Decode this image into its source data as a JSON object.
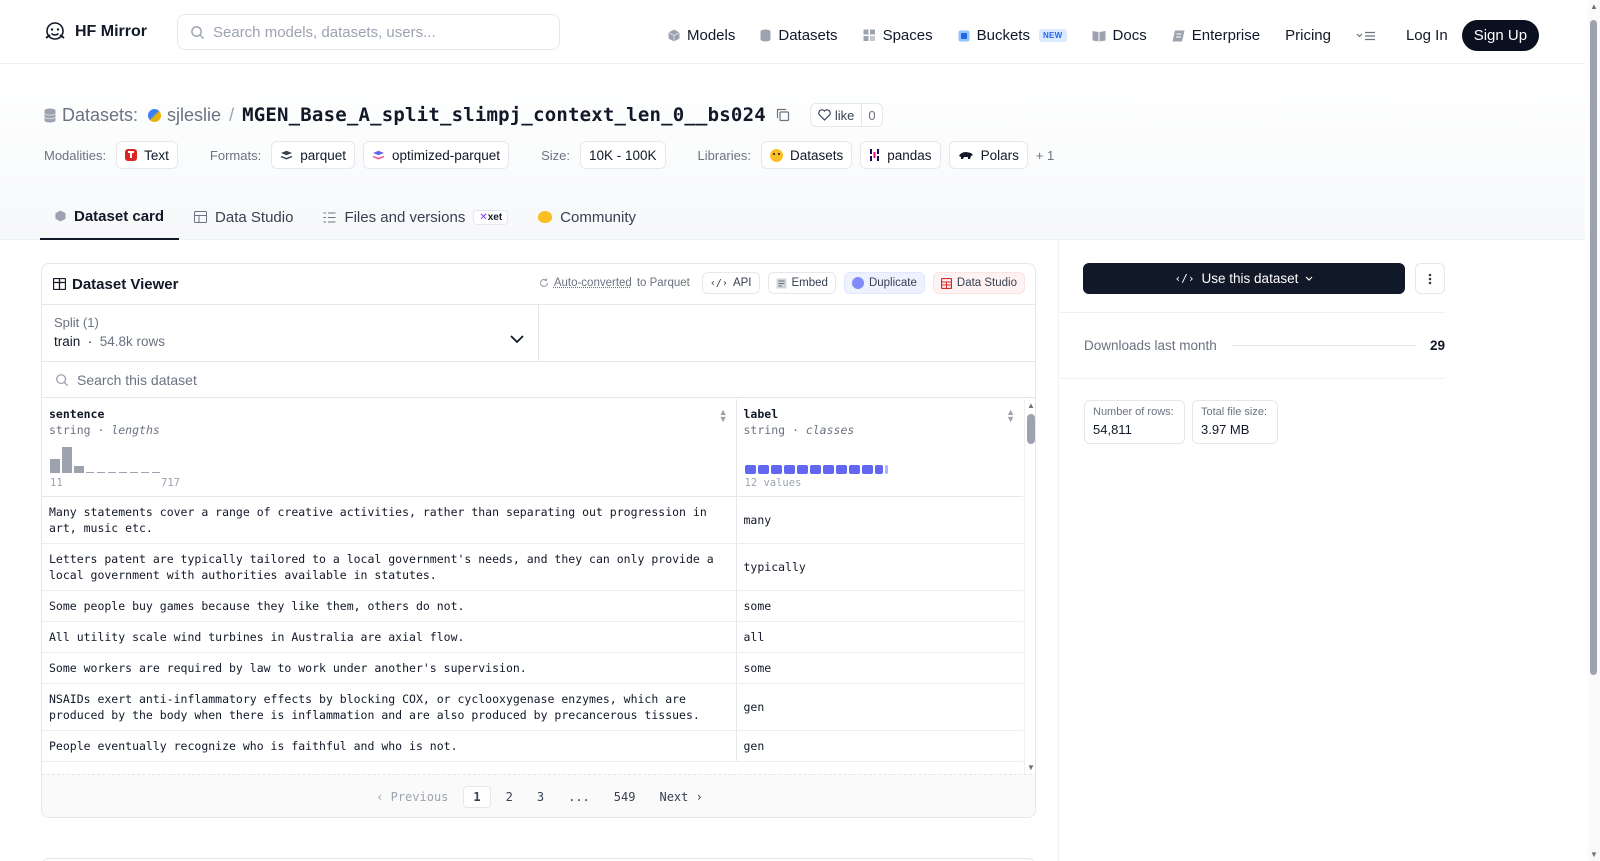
{
  "nav": {
    "brand": "HF Mirror",
    "search_placeholder": "Search models, datasets, users...",
    "links": [
      {
        "label": "Models",
        "icon": "cube-icon"
      },
      {
        "label": "Datasets",
        "icon": "database-icon"
      },
      {
        "label": "Spaces",
        "icon": "grid-icon"
      },
      {
        "label": "Buckets",
        "icon": "bucket-icon"
      },
      {
        "label": "Docs",
        "icon": "book-icon"
      },
      {
        "label": "Enterprise",
        "icon": "enterprise-icon"
      },
      {
        "label": "Pricing"
      }
    ],
    "new_badge": "NEW",
    "login": "Log In",
    "signup": "Sign Up"
  },
  "header": {
    "section_label": "Datasets:",
    "owner": "sjleslie",
    "slash": "/",
    "dataset_name": "MGEN_Base_A_split_slimpj_context_len_0__bs024",
    "like_label": "like",
    "like_count": "0",
    "modalities_label": "Modalities:",
    "modalities": [
      "Text"
    ],
    "formats_label": "Formats:",
    "formats": [
      "parquet",
      "optimized-parquet"
    ],
    "size_label": "Size:",
    "size": "10K - 100K",
    "libraries_label": "Libraries:",
    "libraries": [
      "Datasets",
      "pandas",
      "Polars"
    ],
    "libraries_more": "+ 1"
  },
  "tabs": [
    {
      "label": "Dataset card",
      "active": true
    },
    {
      "label": "Data Studio"
    },
    {
      "label": "Files and versions",
      "badge": "xet"
    },
    {
      "label": "Community"
    }
  ],
  "viewer": {
    "title": "Dataset Viewer",
    "auto_converted": "Auto-converted",
    "to_parquet": "to Parquet",
    "buttons": {
      "api": "API",
      "embed": "Embed",
      "duplicate": "Duplicate",
      "data_studio": "Data Studio"
    },
    "split_label": "Split (1)",
    "split_value": "train",
    "split_rows": "54.8k rows",
    "search_placeholder": "Search this dataset",
    "columns": [
      {
        "name": "sentence",
        "type": "string",
        "stat": "lengths",
        "min": "11",
        "max": "717"
      },
      {
        "name": "label",
        "type": "string",
        "stat": "classes",
        "values_note": "12 values"
      }
    ],
    "rows": [
      {
        "sentence": "Many statements cover a range of creative activities, rather than separating out progression in art, music etc.",
        "label": "many"
      },
      {
        "sentence": "Letters patent are typically tailored to a local government's needs, and they can only provide a local government with authorities available in statutes.",
        "label": "typically"
      },
      {
        "sentence": "Some people buy games because they like them, others do not.",
        "label": "some"
      },
      {
        "sentence": "All utility scale wind turbines in Australia are axial flow.",
        "label": "all"
      },
      {
        "sentence": "Some workers are required by law to work under another's supervision.",
        "label": "some"
      },
      {
        "sentence": "NSAIDs exert anti-inflammatory effects by blocking COX, or cyclooxygenase enzymes, which are produced by the body when there is inflammation and are also produced by precancerous tissues.",
        "label": "gen"
      },
      {
        "sentence": "People eventually recognize who is faithful and who is not.",
        "label": "gen"
      }
    ],
    "pager": {
      "prev": "Previous",
      "pages": [
        "1",
        "2",
        "3",
        "...",
        "549"
      ],
      "next": "Next",
      "current": "1"
    }
  },
  "sidebar": {
    "use_button": "Use this dataset",
    "downloads_label": "Downloads last month",
    "downloads_value": "29",
    "rows_label": "Number of rows:",
    "rows_value": "54,811",
    "size_label": "Total file size:",
    "size_value": "3.97 MB"
  },
  "colors": {
    "accent": "#6366f1",
    "dark": "#111827",
    "muted": "#6b7280"
  }
}
